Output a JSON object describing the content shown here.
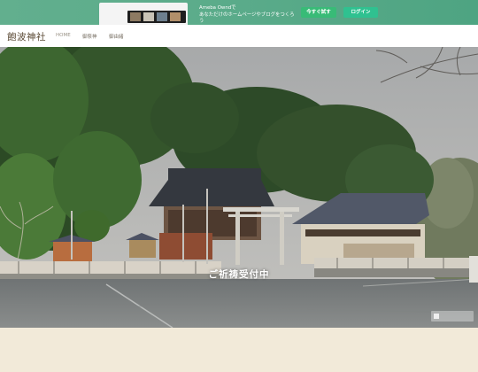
{
  "promo": {
    "text_line1": "Ameba Owndで",
    "text_line2": "あなただけのホームページやブログをつくろう",
    "try_label": "今すぐ試す",
    "login_label": "ログイン",
    "color": "#5aab8a"
  },
  "site": {
    "title": "飽波神社"
  },
  "nav": {
    "items": [
      {
        "label": "HOME"
      },
      {
        "label": "御祭神"
      },
      {
        "label": "御由緒"
      }
    ]
  },
  "hero": {
    "caption": "ご祈祷受付中"
  }
}
